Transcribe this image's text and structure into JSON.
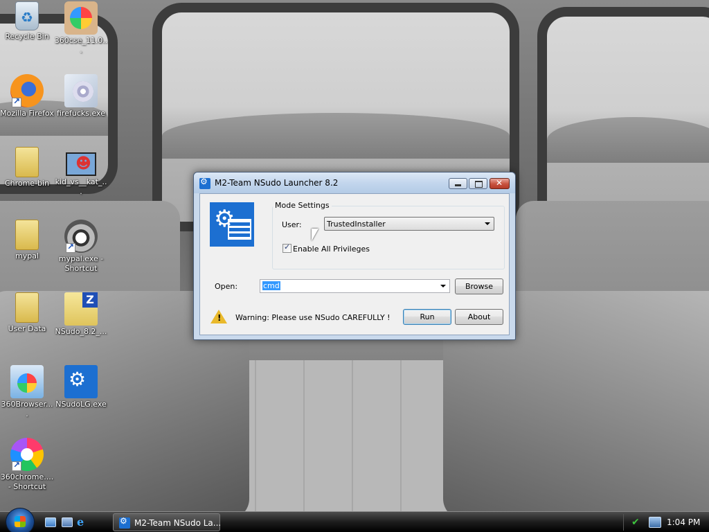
{
  "desktop": {
    "icons": [
      {
        "label": "Recycle Bin",
        "icon": "recycle-bin-icon"
      },
      {
        "label": "360cse_11.0...",
        "icon": "360cse-installer-icon"
      },
      {
        "label": "Mozilla Firefox",
        "icon": "firefox-icon"
      },
      {
        "label": "firefucks.exe",
        "icon": "cd-installer-icon"
      },
      {
        "label": "Chrome-bin",
        "icon": "folder-icon"
      },
      {
        "label": "kid_vs__kat_...",
        "icon": "image-file-icon"
      },
      {
        "label": "mypal",
        "icon": "folder-icon"
      },
      {
        "label": "mypal.exe - Shortcut",
        "icon": "raccoon-icon"
      },
      {
        "label": "User Data",
        "icon": "folder-icon"
      },
      {
        "label": "NSudo_8.2_...",
        "icon": "zip-archive-icon"
      },
      {
        "label": "360Browser....",
        "icon": "360browser-installer-icon"
      },
      {
        "label": "NSudoLG.exe",
        "icon": "nsudo-icon"
      },
      {
        "label": "360chrome.... - Shortcut",
        "icon": "360chrome-icon"
      }
    ]
  },
  "dialog": {
    "title": "M2-Team NSudo Launcher 8.2",
    "mode_settings_label": "Mode Settings",
    "user_label": "User:",
    "user_value": "TrustedInstaller",
    "enable_all_privileges_label": "Enable All Privileges",
    "enable_all_privileges_checked": true,
    "open_label": "Open:",
    "open_value": "cmd",
    "browse_label": "Browse",
    "warning_text": "Warning: Please use NSudo CAREFULLY !",
    "run_label": "Run",
    "about_label": "About"
  },
  "taskbar": {
    "task_button_label": "M2-Team NSudo La...",
    "clock": "1:04 PM"
  }
}
